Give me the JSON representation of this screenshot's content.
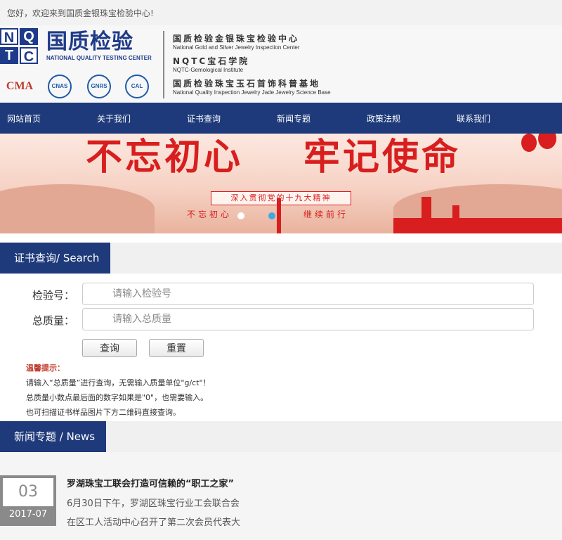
{
  "topbar": {
    "welcome": "您好，欢迎来到国质金银珠宝检验中心!"
  },
  "header": {
    "logo_letters": [
      "N",
      "Q",
      "T",
      "C"
    ],
    "logo_cn": "国质检验",
    "logo_en": "NATIONAL QUALITY TESTING CENTER",
    "badges": [
      "CMA",
      "CNAS",
      "GNRS",
      "CAL"
    ],
    "orgs": [
      {
        "cn": "国质检验金银珠宝检验中心",
        "en": "National Gold and Silver Jewelry Inspection Center"
      },
      {
        "cn": "NQTC宝石学院",
        "en": "NQTC-Gemological Institute"
      },
      {
        "cn": "国质检验珠宝玉石首饰科普基地",
        "en": "National Quality Inspection Jewelry Jade Jewelry Science Base"
      }
    ]
  },
  "nav": [
    "网站首页",
    "关于我们",
    "证书查询",
    "新闻专题",
    "政策法规",
    "联系我们"
  ],
  "banner": {
    "slogan_left": "不忘初心",
    "slogan_right": "牢记使命",
    "ribbon": "深入贯彻党的十九大精神",
    "motto_left": "不忘初心",
    "motto_right": "继续前行",
    "active_slide": 2,
    "slide_count": 2
  },
  "search": {
    "section_title": "证书查询/ Search",
    "label_number": "检验号：",
    "label_weight": "总质量：",
    "placeholder_number": "请输入检验号",
    "placeholder_weight": "请输入总质量",
    "btn_query": "查询",
    "btn_reset": "重置",
    "tip_title": "温馨提示：",
    "tips": [
      "请输入“总质量”进行查询，无需输入质量单位\"g/ct\"！",
      "总质量小数点最后面的数字如果是\"0\"，也需要输入。",
      "也可扫描证书样品图片下方二维码直接查询。"
    ]
  },
  "news": {
    "section_title": "新闻专题 / News",
    "items": [
      {
        "day": "03",
        "year_month": "2017-07",
        "title": "罗湖珠宝工联会打造可信赖的“职工之家”",
        "lines": [
          "6月30日下午，罗湖区珠宝行业工会联合会",
          "在区工人活动中心召开了第二次会员代表大"
        ]
      }
    ]
  }
}
